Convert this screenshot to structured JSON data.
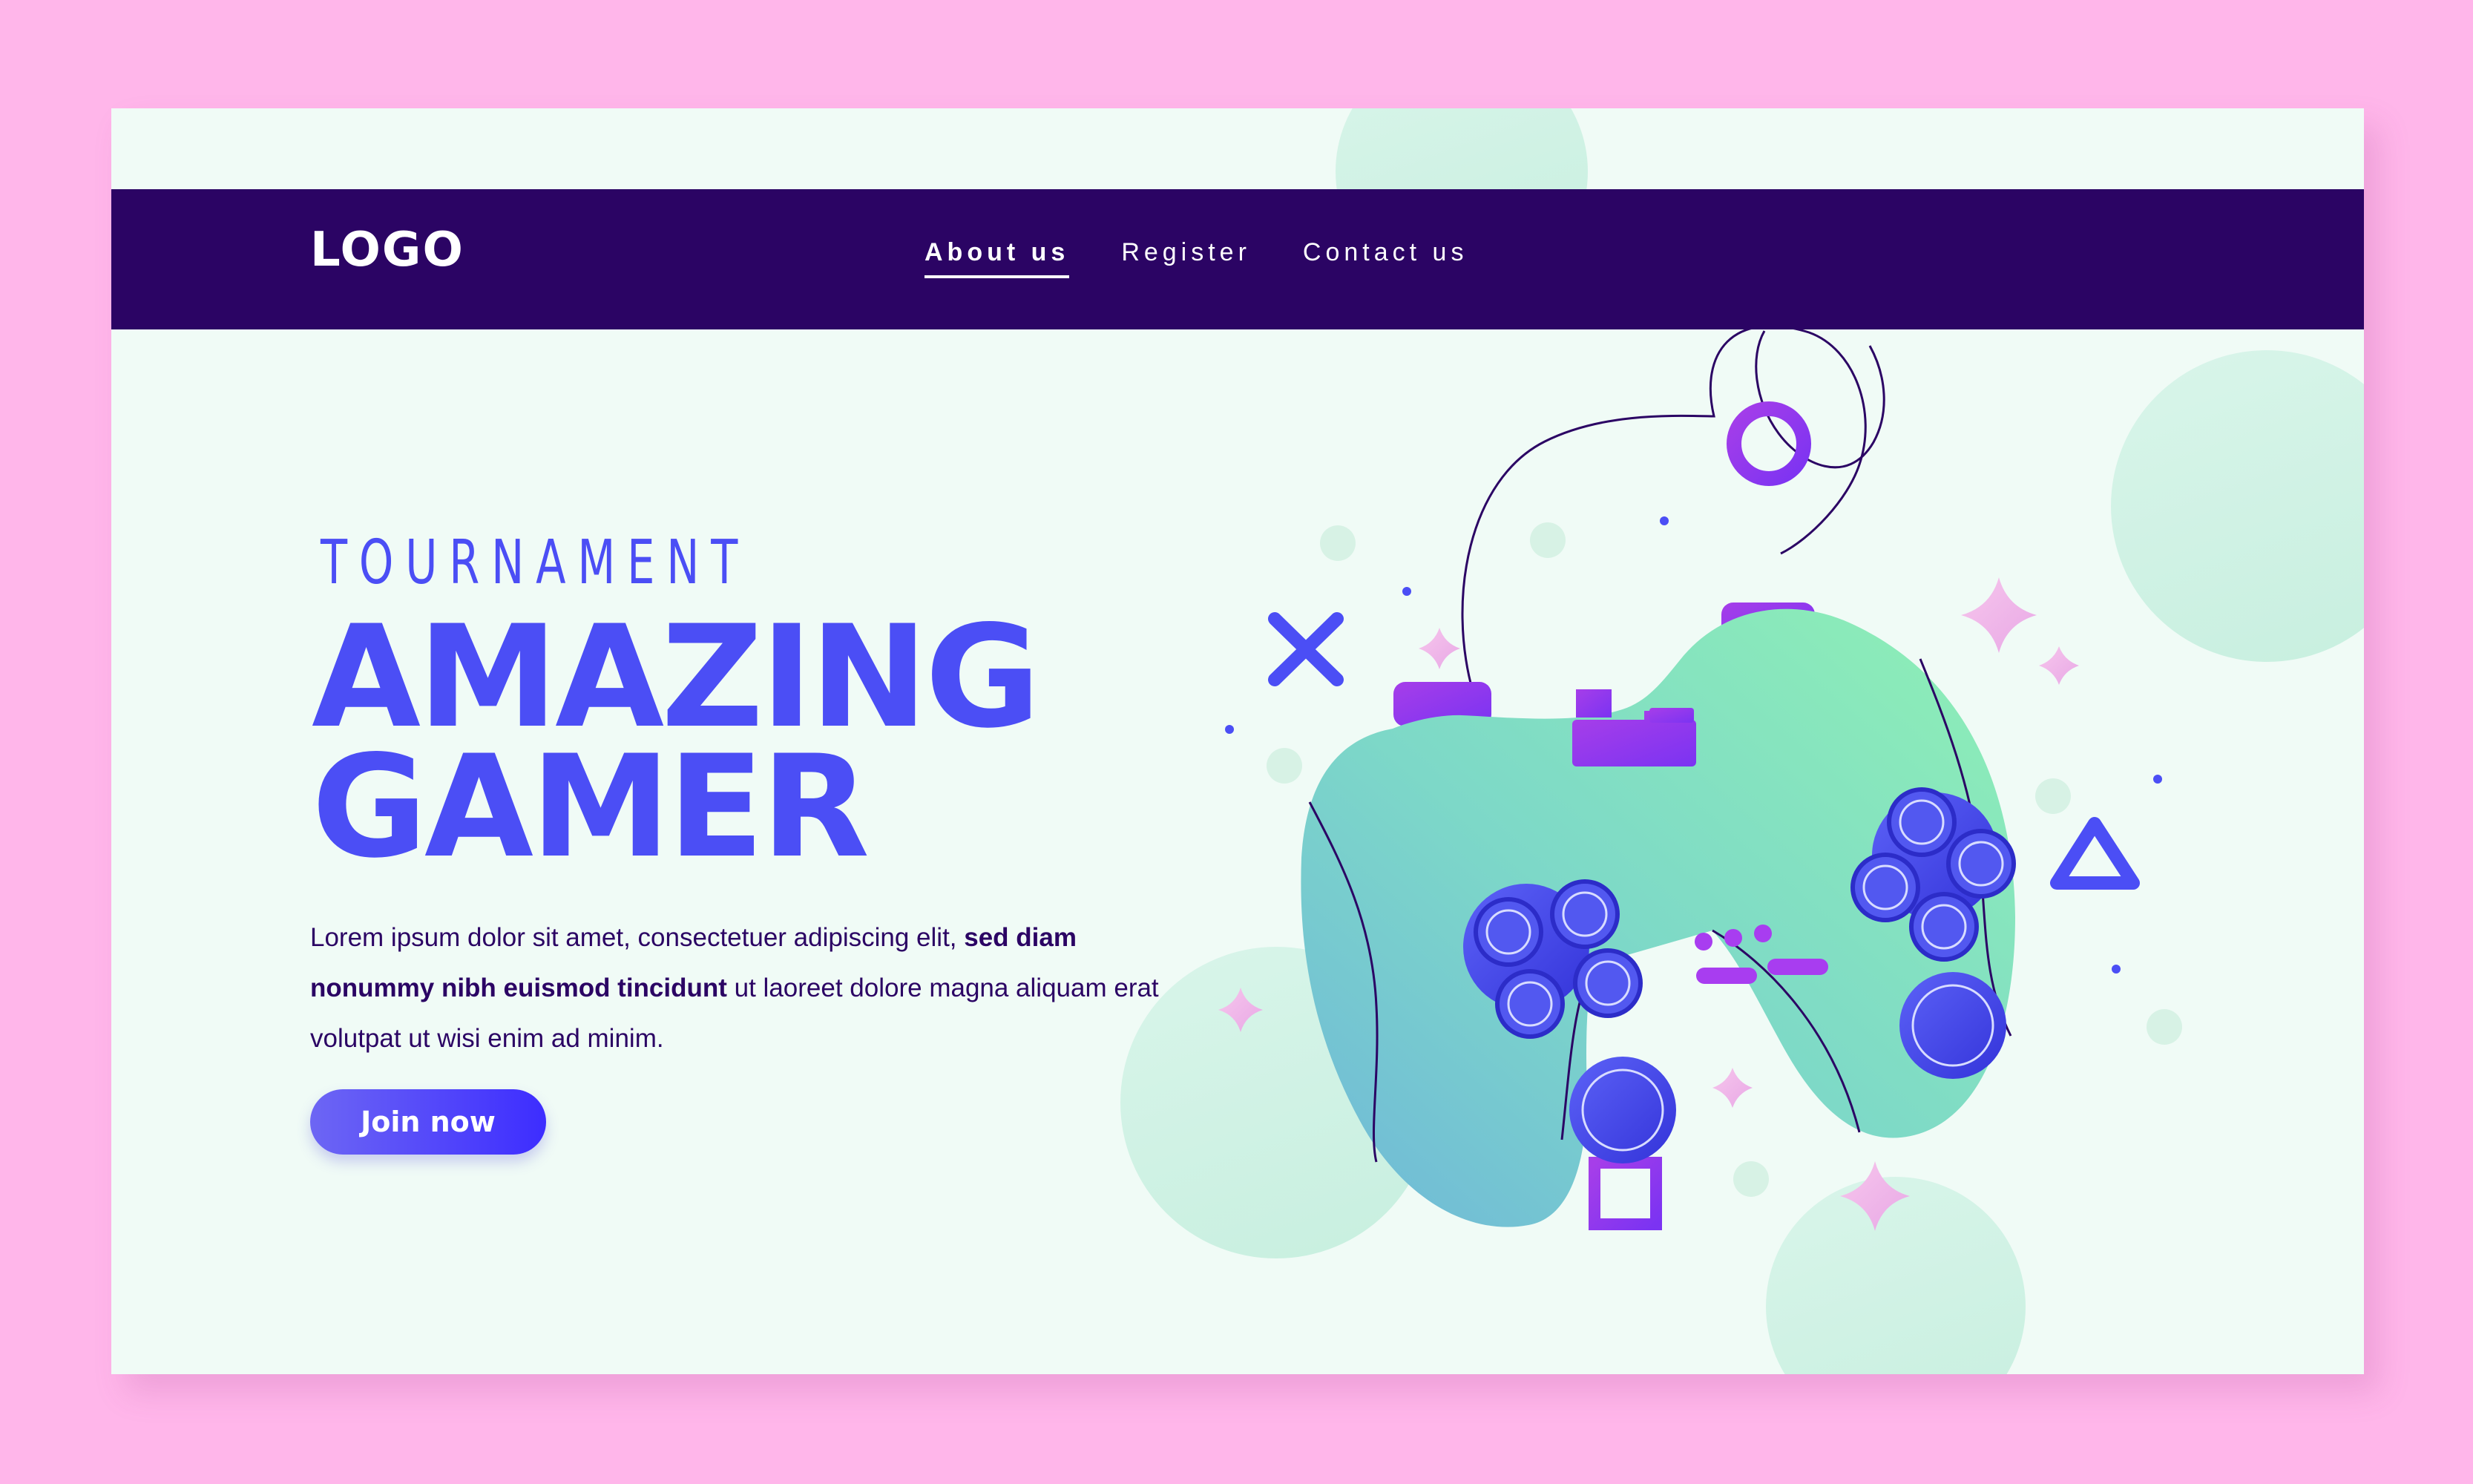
{
  "header": {
    "logo": "LOGO",
    "nav": {
      "about_us": "About us",
      "register": "Register",
      "contact_us": "Contact us"
    }
  },
  "hero": {
    "kicker": "TOURNAMENT",
    "title_line1": "AMAZING",
    "title_line2": "GAMER",
    "paragraph": {
      "part1": "Lorem ipsum dolor sit amet, consectetuer adipiscing elit, ",
      "bold": "sed diam nonummy nibh euismod tincidunt",
      "part2": " ut laoreet dolore magna aliquam erat volutpat ut wisi enim ad minim."
    },
    "cta": "Join now"
  },
  "icons": {
    "controller": "gamepad-icon",
    "cross": "cross-shape-icon",
    "circle": "circle-shape-icon",
    "triangle": "triangle-shape-icon",
    "square": "square-shape-icon",
    "sparkle": "sparkle-icon"
  },
  "colors": {
    "page_background": "#ffb6ea",
    "card_background": "#f0fbf6",
    "nav_background": "#2b0464",
    "accent_blue": "#4b4ef5",
    "accent_purple": "#a83df0",
    "controller_green": "#82e4c2",
    "text_dark": "#2b0464"
  }
}
